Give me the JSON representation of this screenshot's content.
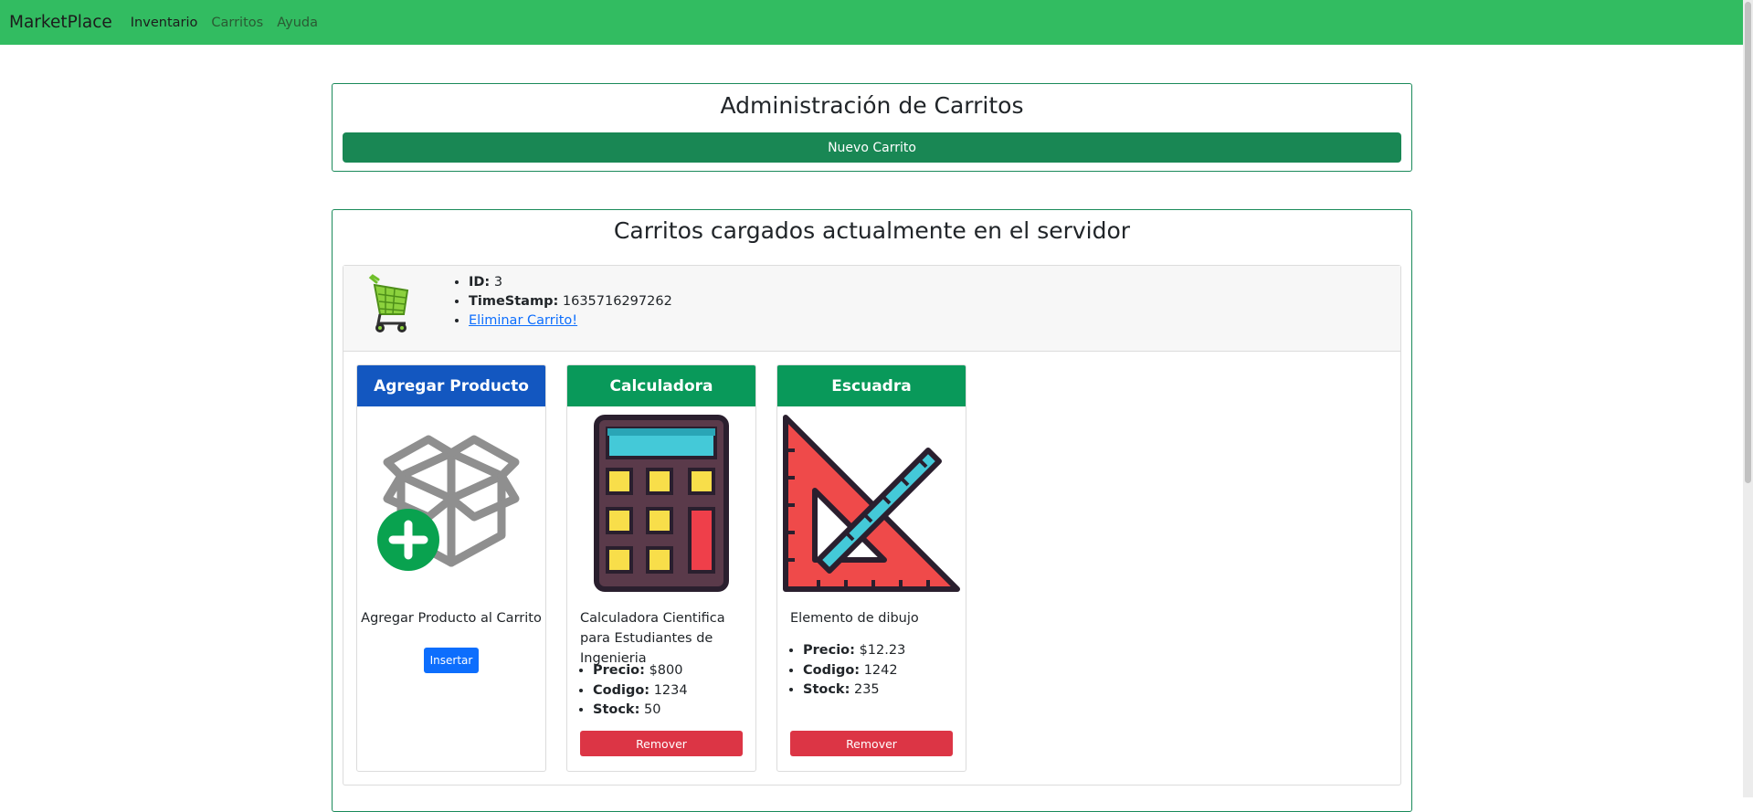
{
  "navbar": {
    "brand": "MarketPlace",
    "links": [
      "Inventario",
      "Carritos",
      "Ayuda"
    ],
    "bg_color": "#32bc61"
  },
  "admin": {
    "title": "Administración de Carritos",
    "new_cart_label": "Nuevo Carrito"
  },
  "carts_section": {
    "title": "Carritos cargados actualmente en el servidor"
  },
  "cart": {
    "icon": "shopping-cart-icon",
    "id_label": "ID:",
    "id_value": "3",
    "timestamp_label": "TimeStamp:",
    "timestamp_value": "1635716297262",
    "delete_link": "Eliminar Carrito!"
  },
  "add_card": {
    "title": "Agregar Producto",
    "icon": "add-box-icon",
    "description": "Agregar Producto al Carrito",
    "button": "Insertar",
    "header_color": "#1357c0"
  },
  "products": [
    {
      "title": "Calculadora",
      "icon": "calculator-icon",
      "description": "Calculadora Cientifica para Estudiantes de Ingenieria",
      "price_label": "Precio:",
      "price": "$800",
      "code_label": "Codigo:",
      "code": "1234",
      "stock_label": "Stock:",
      "stock": "50",
      "button": "Remover",
      "header_color": "#09995a"
    },
    {
      "title": "Escuadra",
      "icon": "set-square-icon",
      "description": "Elemento de dibujo",
      "price_label": "Precio:",
      "price": "$12.23",
      "code_label": "Codigo:",
      "code": "1242",
      "stock_label": "Stock:",
      "stock": "235",
      "button": "Remover",
      "header_color": "#09995a"
    }
  ]
}
